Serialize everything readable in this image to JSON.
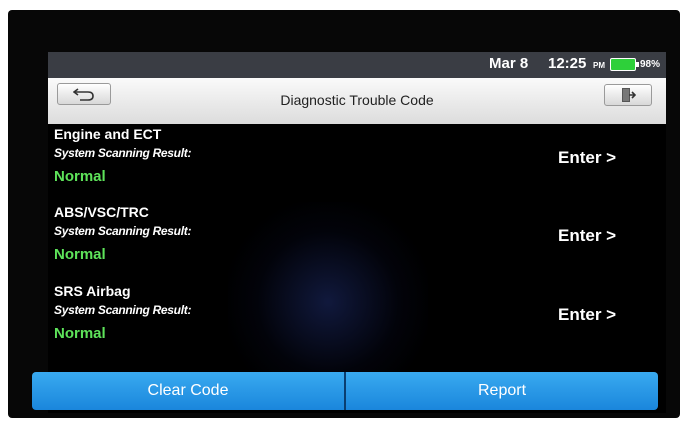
{
  "status": {
    "date": "Mar 8",
    "time": "12:25",
    "ampm": "PM",
    "battery": "98%"
  },
  "header": {
    "title": "Diagnostic Trouble Code"
  },
  "systems": [
    {
      "name": "Engine and ECT",
      "subtitle": "System Scanning Result:",
      "status": "Normal",
      "action": "Enter >"
    },
    {
      "name": "ABS/VSC/TRC",
      "subtitle": "System Scanning Result:",
      "status": "Normal",
      "action": "Enter >"
    },
    {
      "name": "SRS Airbag",
      "subtitle": "System Scanning Result:",
      "status": "Normal",
      "action": "Enter >"
    }
  ],
  "footer": {
    "clear_label": "Clear Code",
    "report_label": "Report"
  },
  "colors": {
    "status_normal": "#5ee35a",
    "button_blue": "#1f8fe3"
  }
}
